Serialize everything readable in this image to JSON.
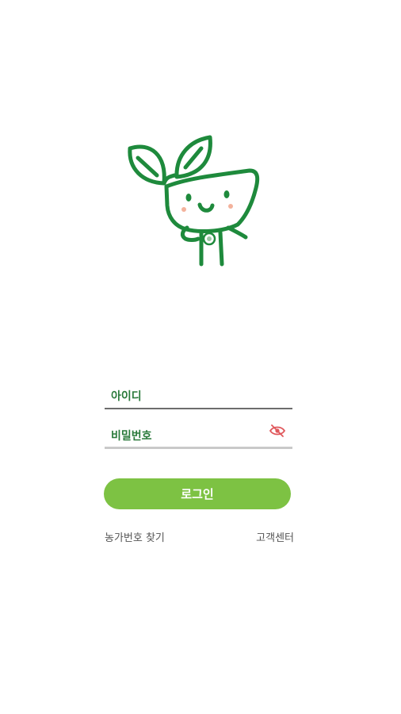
{
  "brand": {
    "mascot_icon": "sprout-mascot-icon",
    "primary_color": "#1e8a3c",
    "accent_color": "#7dc243"
  },
  "login_form": {
    "id_placeholder": "아이디",
    "password_placeholder": "비밀번호",
    "password_toggle_icon": "eye-slash-icon",
    "login_button_label": "로그인"
  },
  "links": {
    "find_farm_number": "농가번호 찾기",
    "customer_center": "고객센터"
  }
}
